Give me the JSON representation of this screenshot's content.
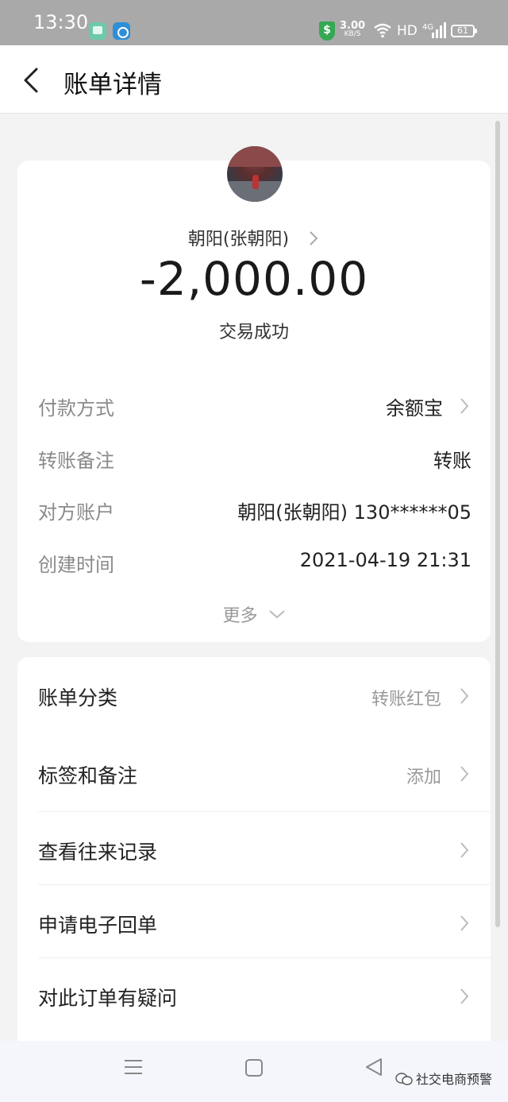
{
  "status_bar": {
    "time": "13:30",
    "speed_value": "3.00",
    "speed_unit": "KB/S",
    "network": "HD",
    "network_gen": "4G",
    "battery": "61"
  },
  "header": {
    "title": "账单详情"
  },
  "transaction": {
    "payee": "朝阳(张朝阳)",
    "amount": "-2,000.00",
    "status": "交易成功"
  },
  "details": [
    {
      "label": "付款方式",
      "value": "余额宝"
    },
    {
      "label": "转账备注",
      "value": "转账"
    },
    {
      "label": "对方账户",
      "value": "朝阳(张朝阳) 130******05"
    },
    {
      "label": "创建时间",
      "value": "2021-04-19 21:31"
    }
  ],
  "more_label": "更多",
  "menu": [
    {
      "label": "账单分类",
      "value": "转账红包"
    },
    {
      "label": "标签和备注",
      "value": "添加"
    },
    {
      "label": "查看往来记录",
      "value": ""
    },
    {
      "label": "申请电子回单",
      "value": ""
    },
    {
      "label": "对此订单有疑问",
      "value": ""
    }
  ],
  "watermark": "社交电商预警",
  "colors": {
    "status_bar": "#a9a9a9",
    "page_bg": "#f3f3f3",
    "card_bg": "#ffffff",
    "muted_text": "#8a8a8a"
  }
}
